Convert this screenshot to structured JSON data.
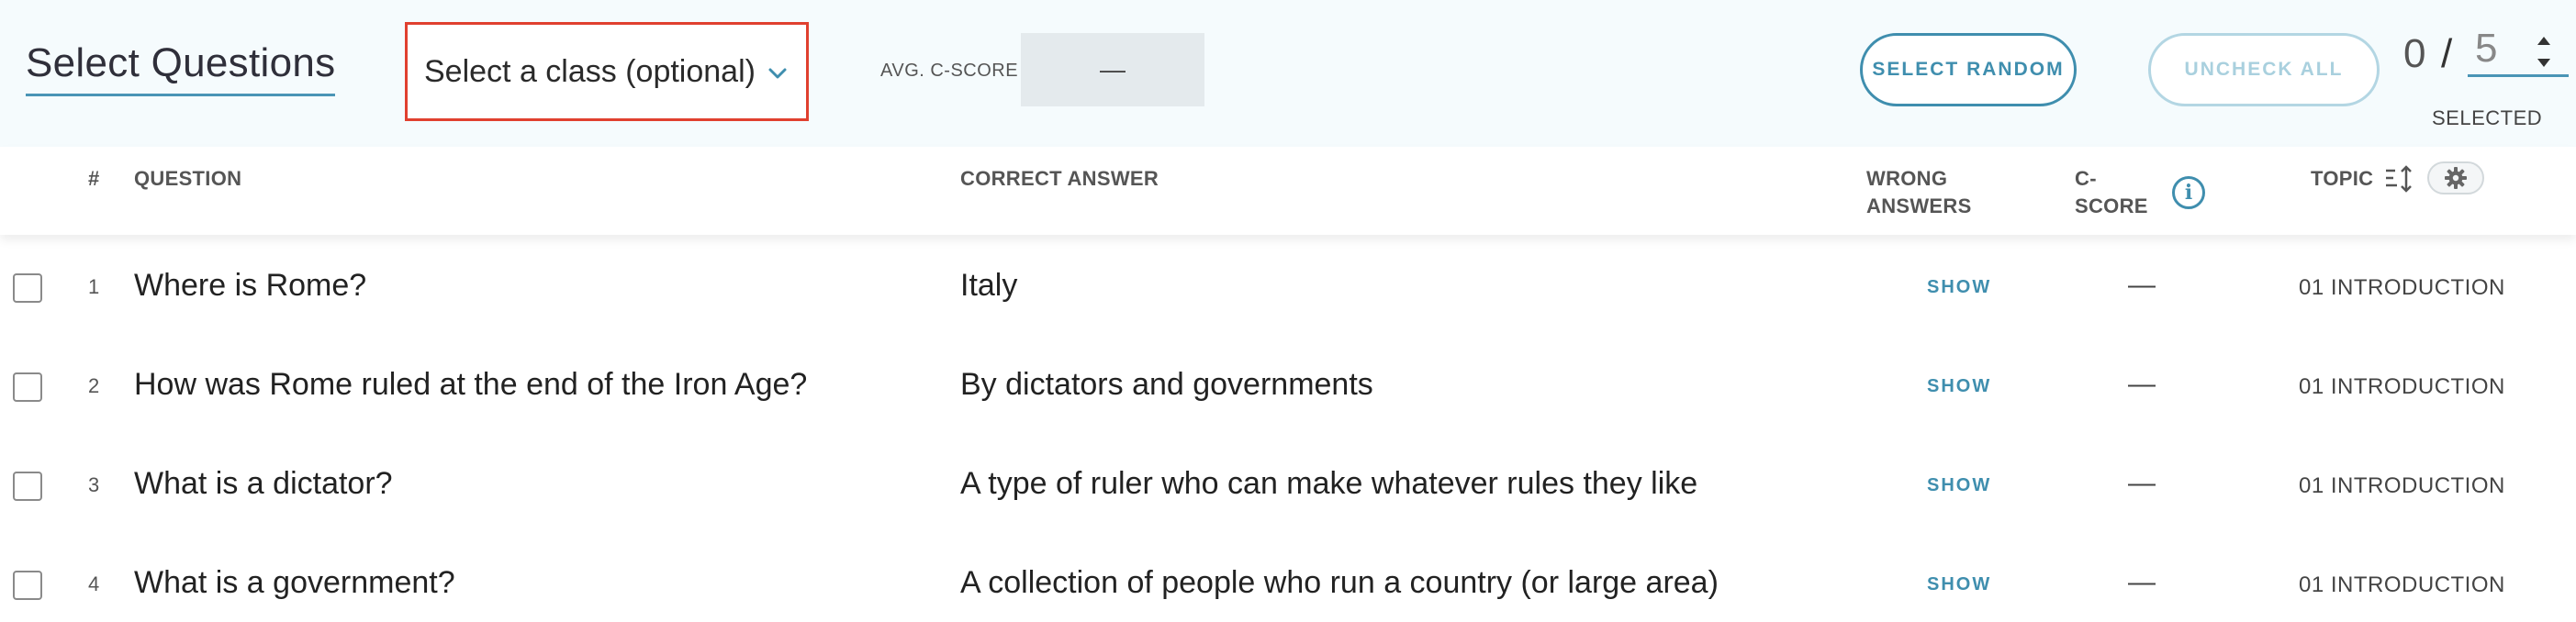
{
  "header": {
    "title": "Select Questions",
    "class_select": {
      "value": "Select a class (optional)"
    },
    "avg_cscore": {
      "label": "AVG. C-SCORE",
      "value": "—"
    },
    "select_random_label": "SELECT RANDOM",
    "uncheck_all_label": "UNCHECK ALL",
    "counter": {
      "selected": "0",
      "slash": "/",
      "max": "5",
      "label": "SELECTED"
    }
  },
  "table": {
    "columns": {
      "number": "#",
      "question": "QUESTION",
      "correct_answer": "CORRECT ANSWER",
      "wrong_answers_line1": "WRONG",
      "wrong_answers_line2": "ANSWERS",
      "cscore_line1": "C-",
      "cscore_line2": "SCORE",
      "topic": "TOPIC"
    },
    "rows": [
      {
        "number": "1",
        "question": "Where is Rome?",
        "answer": "Italy",
        "wrong": "SHOW",
        "cscore": "—",
        "topic": "01 INTRODUCTION",
        "checked": false
      },
      {
        "number": "2",
        "question": "How was Rome ruled at the end of the Iron Age?",
        "answer": "By dictators and governments",
        "wrong": "SHOW",
        "cscore": "—",
        "topic": "01 INTRODUCTION",
        "checked": false
      },
      {
        "number": "3",
        "question": "What is a dictator?",
        "answer": "A type of ruler who can make whatever rules they like",
        "wrong": "SHOW",
        "cscore": "—",
        "topic": "01 INTRODUCTION",
        "checked": false
      },
      {
        "number": "4",
        "question": "What is a government?",
        "answer": "A collection of people who run a country (or large area)",
        "wrong": "SHOW",
        "cscore": "—",
        "topic": "01 INTRODUCTION",
        "checked": false
      }
    ]
  },
  "icons": {
    "chevron": "chevron-down-icon",
    "info": "info-icon",
    "sort": "sort-icon",
    "settings": "gear-icon"
  },
  "colors": {
    "accent": "#3f8eae",
    "highlight_border": "#e0402f",
    "topbar_bg": "#f5fbfd"
  }
}
